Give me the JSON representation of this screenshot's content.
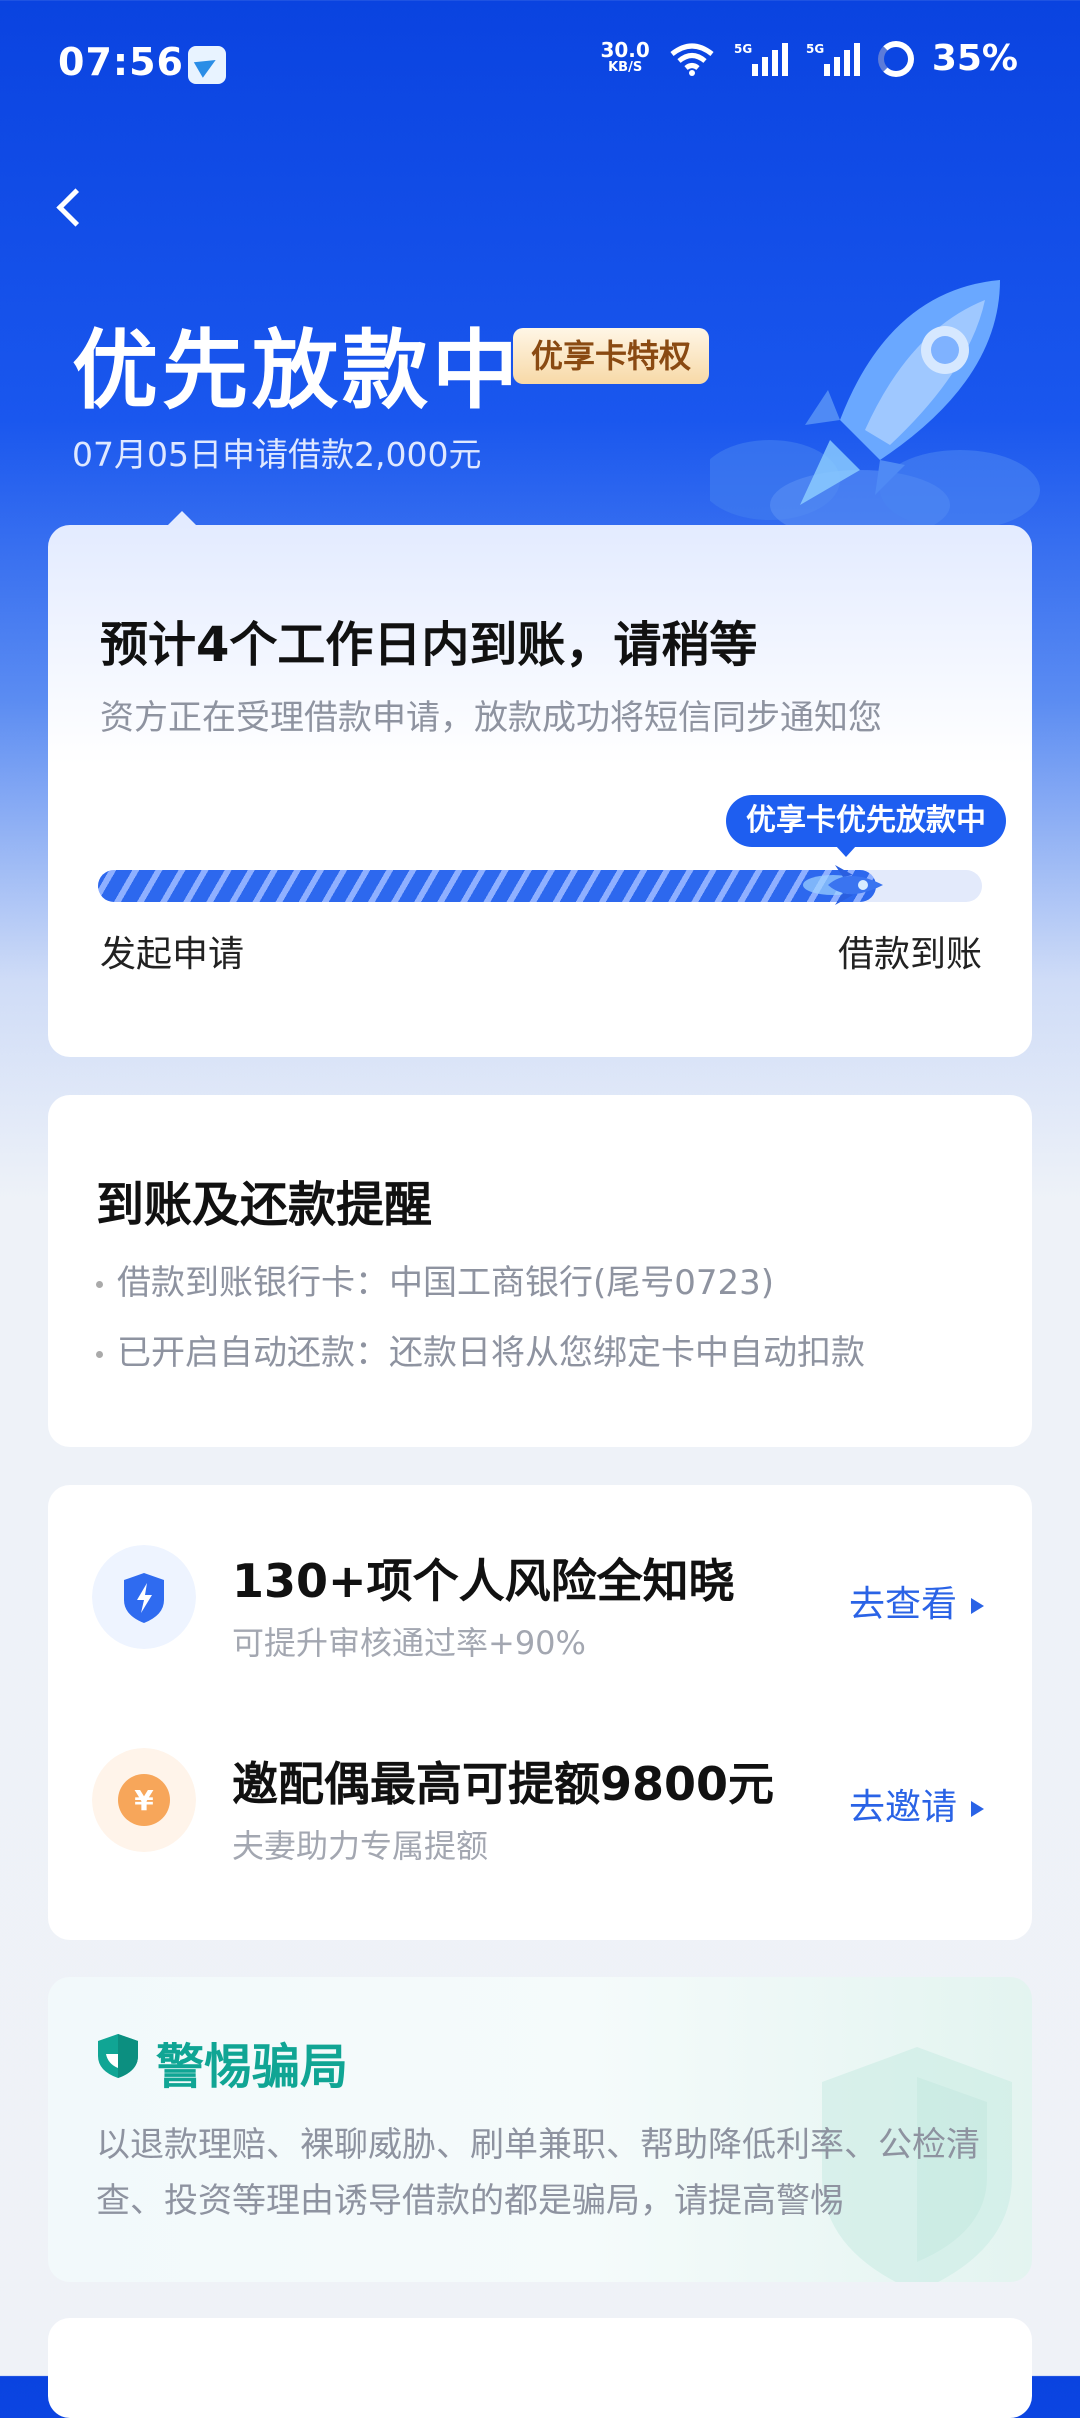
{
  "status_bar": {
    "time": "07:56",
    "net_speed": "30.0",
    "net_unit": "KB/S",
    "signal_1": "5G",
    "signal_2": "5G",
    "battery": "35%"
  },
  "header": {
    "title": "优先放款中",
    "badge": "优享卡特权",
    "subtitle": "07月05日申请借款2,000元"
  },
  "progress": {
    "title": "预计4个工作日内到账，请稍等",
    "description": "资方正在受理借款申请，放款成功将短信同步通知您",
    "bubble": "优享卡优先放款中",
    "fraction": 0.88,
    "start_label": "发起申请",
    "end_label": "借款到账"
  },
  "reminder": {
    "title": "到账及还款提醒",
    "items": [
      "借款到账银行卡：中国工商银行(尾号0723)",
      "已开启自动还款：还款日将从您绑定卡中自动扣款"
    ]
  },
  "promos": [
    {
      "icon": "shield-lightning-icon",
      "title": "130+项个人风险全知晓",
      "subtitle": "可提升审核通过率+90%",
      "link": "去查看"
    },
    {
      "icon": "yuan-coin-icon",
      "title": "邀配偶最高可提额9800元",
      "subtitle": "夫妻助力专属提额",
      "link": "去邀请"
    }
  ],
  "warning": {
    "title": "警惕骗局",
    "text": "以退款理赔、裸聊威胁、刷单兼职、帮助降低利率、公检清查、投资等理由诱导借款的都是骗局，请提高警惕"
  },
  "colors": {
    "brand_blue": "#1e5ef0",
    "link_blue": "#2a63e6",
    "warning_teal": "#10a594",
    "badge_gold": "#f7d9a7"
  }
}
